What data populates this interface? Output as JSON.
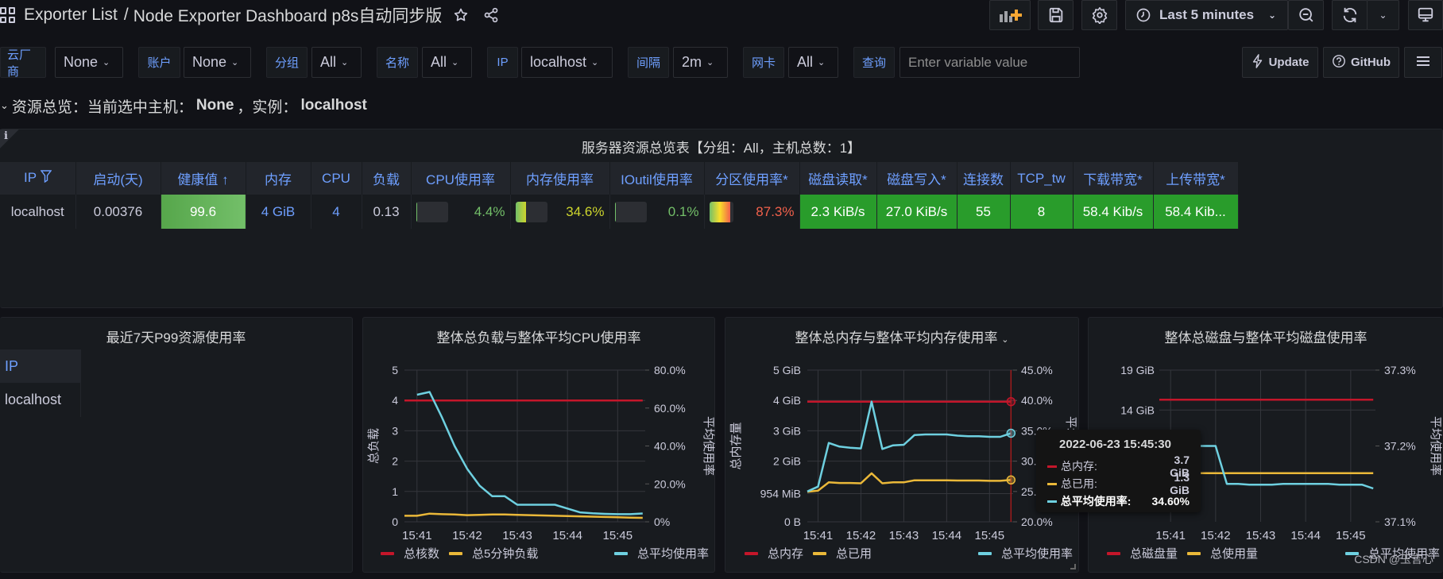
{
  "header": {
    "breadcrumb_parent": "Exporter List",
    "breadcrumb_separator": "/",
    "dashboard_title": "Node Exporter Dashboard p8s自动同步版",
    "time_range": "Last 5 minutes"
  },
  "icons": {
    "apps": "grid-icon",
    "star": "star-icon",
    "share": "share-icon",
    "add_panel": "add-panel-icon",
    "save": "save-icon",
    "settings": "gear-icon",
    "clock": "clock-icon",
    "zoom_out": "zoom-out-icon",
    "refresh": "refresh-icon",
    "tv": "tv-mode-icon"
  },
  "variables": [
    {
      "label": "云厂商",
      "value": "None"
    },
    {
      "label": "账户",
      "value": "None"
    },
    {
      "label": "分组",
      "value": "All"
    },
    {
      "label": "名称",
      "value": "All"
    },
    {
      "label": "IP",
      "value": "localhost"
    },
    {
      "label": "间隔",
      "value": "2m"
    },
    {
      "label": "网卡",
      "value": "All"
    }
  ],
  "query_var": {
    "label": "查询",
    "placeholder": "Enter variable value"
  },
  "links": {
    "update": "Update",
    "github": "GitHub"
  },
  "row": {
    "prefix": "资源总览：当前选中主机：",
    "host": "None",
    "middle": "，实例：",
    "instance": "localhost"
  },
  "server_table": {
    "title": "服务器资源总览表【分组：All，主机总数：1】",
    "info_icon": "i",
    "columns": [
      "IP",
      "启动(天)",
      "健康值",
      "内存",
      "CPU",
      "负载",
      "CPU使用率",
      "内存使用率",
      "IOutil使用率",
      "分区使用率*",
      "磁盘读取*",
      "磁盘写入*",
      "连接数",
      "TCP_tw",
      "下载带宽*",
      "上传带宽*"
    ],
    "sort_indicator": "↑",
    "rows": [
      {
        "ip": "localhost",
        "uptime_days": "0.00376",
        "health": "99.6",
        "memory": "4 GiB",
        "cpu": "4",
        "load": "0.13",
        "cpu_usage": "4.4%",
        "cpu_usage_fraction": 0.044,
        "mem_usage": "34.6%",
        "mem_usage_fraction": 0.346,
        "ioutil": "0.1%",
        "ioutil_fraction": 0.001,
        "partition_usage": "87.3%",
        "partition_usage_fraction": 0.873,
        "disk_read": "2.3 KiB/s",
        "disk_write": "27.0 KiB/s",
        "connections": "55",
        "tcp_tw": "8",
        "download": "58.4 Kib/s",
        "upload": "58.4 Kib..."
      }
    ],
    "colors": {
      "header_text": "#6e9fff",
      "green": "#299c2b",
      "cpu_text": "#73bf69",
      "mem_text": "#cdd52d",
      "io_text": "#73bf69",
      "part_text": "#f2614b"
    }
  },
  "p99_panel": {
    "title": "最近7天P99资源使用率",
    "header": "IP",
    "rows": [
      "localhost"
    ]
  },
  "chart_data": [
    {
      "type": "line",
      "title": "整体总负载与整体平均CPU使用率",
      "xlabel": "",
      "ylabel": "总负载",
      "ylabel_right": "平均使用率",
      "x_ticks": [
        "15:41",
        "15:42",
        "15:43",
        "15:44",
        "15:45"
      ],
      "y_ticks": [
        "0",
        "1",
        "2",
        "3",
        "4",
        "5"
      ],
      "y_ticks_right": [
        "0%",
        "20.0%",
        "40.0%",
        "60.0%",
        "80.0%"
      ],
      "ylim": [
        0,
        5
      ],
      "ylim_right": [
        0,
        80
      ],
      "xlim_minutes": [
        40.8,
        45.55
      ],
      "grid": true,
      "legend_position": "bottom",
      "series": [
        {
          "name": "总核数",
          "color": "#c4162a",
          "axis": "left",
          "x": [
            40.75,
            45.5
          ],
          "values": [
            4,
            4
          ]
        },
        {
          "name": "总5分钟负载",
          "color": "#eab839",
          "axis": "left",
          "x": [
            40.75,
            41.0,
            41.25,
            41.5,
            41.75,
            42.0,
            42.25,
            42.5,
            42.75,
            43.0,
            43.25,
            43.5,
            43.75,
            44.0,
            44.25,
            44.5,
            44.75,
            45.0,
            45.25,
            45.5
          ],
          "values": [
            0.2,
            0.2,
            0.27,
            0.25,
            0.24,
            0.22,
            0.23,
            0.24,
            0.24,
            0.23,
            0.22,
            0.21,
            0.2,
            0.19,
            0.18,
            0.17,
            0.16,
            0.15,
            0.14,
            0.13
          ]
        },
        {
          "name": "总平均使用率",
          "color": "#6ed0e0",
          "axis": "right",
          "x": [
            41.0,
            41.25,
            41.5,
            41.75,
            42.0,
            42.25,
            42.5,
            42.75,
            43.0,
            43.25,
            43.5,
            43.75,
            44.0,
            44.25,
            44.5,
            44.75,
            45.0,
            45.25,
            45.5
          ],
          "values": [
            67,
            68.5,
            55,
            40,
            28,
            19,
            13.5,
            13.5,
            9,
            9,
            9,
            9,
            7,
            5,
            4.5,
            4.2,
            4.0,
            4.0,
            4.4
          ]
        }
      ]
    },
    {
      "type": "line",
      "title": "整体总内存与整体平均内存使用率",
      "xlabel": "",
      "ylabel": "总内存量",
      "ylabel_right": "平均使用率",
      "x_ticks": [
        "15:41",
        "15:42",
        "15:43",
        "15:44",
        "15:45"
      ],
      "y_ticks": [
        "0 B",
        "954 MiB",
        "2 GiB",
        "3 GiB",
        "4 GiB",
        "5 GiB"
      ],
      "y_ticks_right": [
        "20.0%",
        "25.0%",
        "30.0%",
        "35.0%",
        "40.0%",
        "45.0%"
      ],
      "ylim": [
        0,
        5
      ],
      "ylim_right": [
        20,
        45
      ],
      "grid": true,
      "legend_position": "bottom",
      "series": [
        {
          "name": "总内存",
          "color": "#c4162a",
          "axis": "left",
          "x": [
            40.75,
            45.5
          ],
          "values": [
            3.96,
            3.96
          ]
        },
        {
          "name": "总已用",
          "color": "#eab839",
          "axis": "left",
          "x": [
            40.75,
            41.0,
            41.25,
            41.5,
            41.75,
            42.0,
            42.25,
            42.5,
            42.75,
            43.0,
            43.25,
            43.5,
            43.75,
            44.0,
            44.25,
            44.5,
            44.75,
            45.0,
            45.25,
            45.5
          ],
          "values": [
            0.99,
            1.03,
            1.3,
            1.28,
            1.28,
            1.27,
            1.6,
            1.27,
            1.3,
            1.3,
            1.37,
            1.37,
            1.37,
            1.37,
            1.36,
            1.36,
            1.36,
            1.35,
            1.35,
            1.38
          ]
        },
        {
          "name": "总平均使用率",
          "color": "#6ed0e0",
          "axis": "right",
          "x": [
            40.75,
            41.0,
            41.25,
            41.5,
            41.75,
            42.0,
            42.25,
            42.5,
            42.75,
            43.0,
            43.25,
            43.5,
            43.75,
            44.0,
            44.25,
            44.5,
            44.75,
            45.0,
            45.25,
            45.5
          ],
          "values": [
            25,
            25.8,
            33,
            32.4,
            32.2,
            32.1,
            39.8,
            32,
            32.6,
            32.7,
            34.3,
            34.4,
            34.4,
            34.4,
            34.2,
            34.1,
            34.1,
            34.0,
            34.0,
            34.6
          ]
        }
      ],
      "hover_x": 45.5,
      "tooltip": {
        "time": "2022-06-23 15:45:30",
        "rows": [
          {
            "label": "总内存:",
            "value": "3.7 GiB",
            "color": "#c4162a"
          },
          {
            "label": "总已用:",
            "value": "1.3 GiB",
            "color": "#eab839"
          },
          {
            "label": "总平均使用率:",
            "value": "34.60%",
            "color": "#6ed0e0",
            "highlight": true
          }
        ]
      }
    },
    {
      "type": "line",
      "title": "整体总磁盘与整体平均磁盘使用率",
      "xlabel": "",
      "ylabel": "",
      "ylabel_right": "平均使用率",
      "x_ticks": [
        "15:41",
        "15:42",
        "15:43",
        "15:44",
        "15:45"
      ],
      "y_ticks": [
        "14 GiB",
        "19 GiB"
      ],
      "y_ticks_right": [
        "37.1%",
        "37.2%",
        "37.3%"
      ],
      "ylim": [
        0,
        19
      ],
      "ylim_right": [
        37.1,
        37.3
      ],
      "grid": true,
      "legend_position": "bottom",
      "series": [
        {
          "name": "总磁盘量",
          "color": "#c4162a",
          "axis": "left",
          "x": [
            40.75,
            45.5
          ],
          "values": [
            15.3,
            15.3
          ]
        },
        {
          "name": "总使用量",
          "color": "#eab839",
          "axis": "left",
          "x": [
            40.75,
            45.5
          ],
          "values": [
            6.1,
            6.1
          ]
        },
        {
          "name": "总平均使用率",
          "color": "#6ed0e0",
          "axis": "right",
          "x": [
            40.75,
            41.0,
            41.25,
            41.75,
            42.0,
            42.25,
            42.5,
            42.75,
            43.0,
            43.25,
            43.5,
            43.75,
            44.0,
            44.25,
            44.5,
            44.75,
            45.0,
            45.25,
            45.5
          ],
          "values": [
            37.2,
            37.2,
            37.2,
            37.2,
            37.2,
            37.15,
            37.15,
            37.149,
            37.149,
            37.149,
            37.15,
            37.15,
            37.15,
            37.15,
            37.15,
            37.149,
            37.149,
            37.149,
            37.144
          ]
        }
      ]
    }
  ],
  "watermark": "CSDN @玉言心"
}
